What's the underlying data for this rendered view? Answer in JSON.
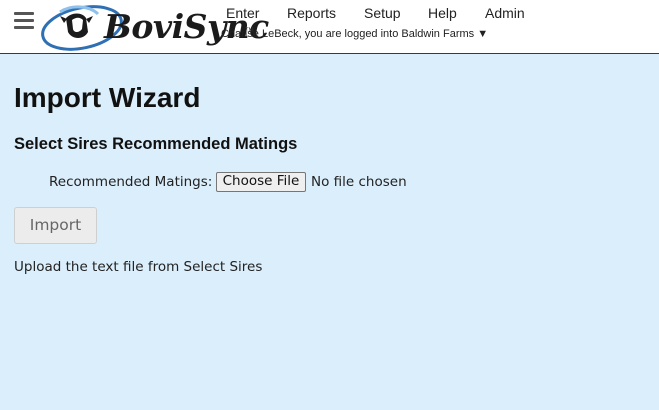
{
  "header": {
    "menu_icon": "hamburger-menu-icon",
    "logo": {
      "text": "BoviSync",
      "trademark": "TM",
      "icon": "cow-head-swirl-logo"
    },
    "nav": [
      {
        "label": "Enter"
      },
      {
        "label": "Reports"
      },
      {
        "label": "Setup"
      },
      {
        "label": "Help"
      },
      {
        "label": "Admin"
      }
    ],
    "user_line": "Chanse LeBeck, you are logged into Baldwin Farms ▼"
  },
  "main": {
    "title": "Import Wizard",
    "subtitle": "Select Sires Recommended Matings",
    "file_field": {
      "label": "Recommended Matings:",
      "button_label": "Choose File",
      "status": "No file chosen"
    },
    "import_button": "Import",
    "help_text": "Upload the text file from Select Sires"
  },
  "colors": {
    "page_background": "#dbeefb",
    "header_background": "#ffffff",
    "logo_blue": "#2f6fb3"
  }
}
